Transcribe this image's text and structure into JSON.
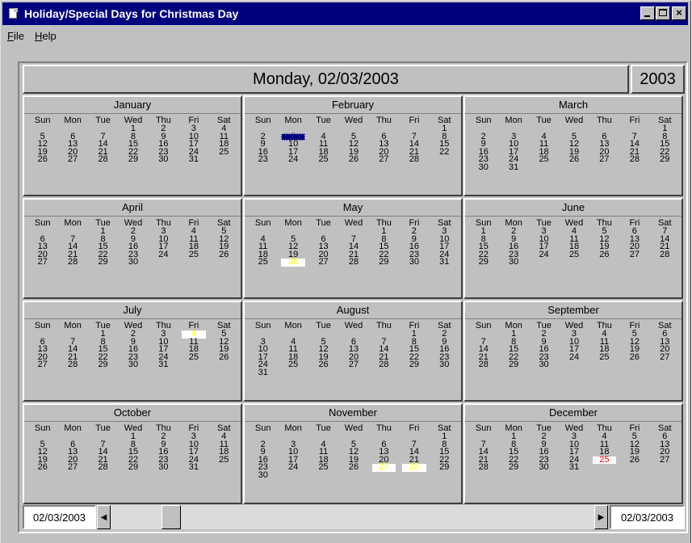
{
  "window": {
    "title": "Holiday/Special Days for Christmas Day"
  },
  "menu": [
    {
      "underline": "F",
      "rest": "ile"
    },
    {
      "underline": "H",
      "rest": "elp"
    }
  ],
  "header": {
    "date": "Monday, 02/03/2003",
    "year": "2003"
  },
  "day_names": [
    "Sun",
    "Mon",
    "Tue",
    "Wed",
    "Thu",
    "Fri",
    "Sat"
  ],
  "months": [
    {
      "name": "January",
      "start": 3,
      "days": 31
    },
    {
      "name": "February",
      "start": 6,
      "days": 28
    },
    {
      "name": "March",
      "start": 6,
      "days": 31
    },
    {
      "name": "April",
      "start": 2,
      "days": 30
    },
    {
      "name": "May",
      "start": 4,
      "days": 31
    },
    {
      "name": "June",
      "start": 0,
      "days": 30
    },
    {
      "name": "July",
      "start": 2,
      "days": 31
    },
    {
      "name": "August",
      "start": 5,
      "days": 31
    },
    {
      "name": "September",
      "start": 1,
      "days": 30
    },
    {
      "name": "October",
      "start": 3,
      "days": 31
    },
    {
      "name": "November",
      "start": 6,
      "days": 30
    },
    {
      "name": "December",
      "start": 1,
      "days": 31
    }
  ],
  "selected": {
    "month": 2,
    "day": 3
  },
  "highlights": [
    {
      "month": 5,
      "day": 26,
      "color": "#ffff00"
    },
    {
      "month": 7,
      "day": 4,
      "color": "#ffff00"
    },
    {
      "month": 11,
      "day": 27,
      "color": "#ffff00"
    },
    {
      "month": 11,
      "day": 28,
      "color": "#ffff00"
    },
    {
      "month": 12,
      "day": 25,
      "color": "#ff0000"
    }
  ],
  "scrollbar": {
    "left_date": "02/03/2003",
    "right_date": "02/03/2003",
    "position": 0.11
  }
}
